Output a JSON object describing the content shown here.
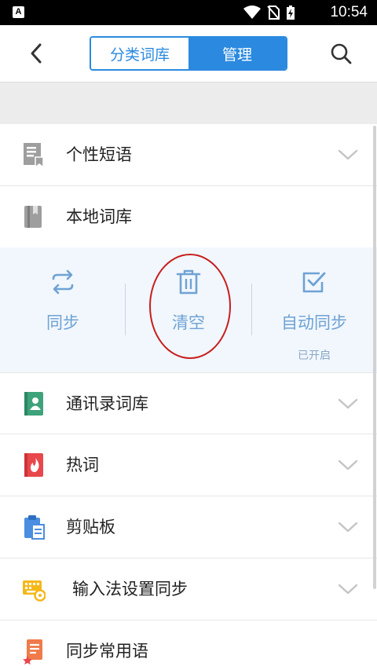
{
  "status_bar": {
    "time": "10:54",
    "notification_badge": "A"
  },
  "nav": {
    "tabs": [
      {
        "label": "分类词库",
        "active": false
      },
      {
        "label": "管理",
        "active": true
      }
    ]
  },
  "list": {
    "personal_phrases": "个性短语",
    "local_dict": "本地词库",
    "contacts_dict": "通讯录词库",
    "hot_words": "热词",
    "clipboard": "剪贴板",
    "ime_settings_sync": "输入法设置同步",
    "sync_common_phrases": "同步常用语"
  },
  "local_dict_actions": {
    "sync": "同步",
    "clear": "清空",
    "auto_sync": "自动同步",
    "auto_sync_status": "已开启"
  },
  "colors": {
    "accent": "#2b8ae0",
    "action_text": "#6fa2d4",
    "panel_bg": "#f1f7fd",
    "annotation_circle": "#c81e1e"
  }
}
